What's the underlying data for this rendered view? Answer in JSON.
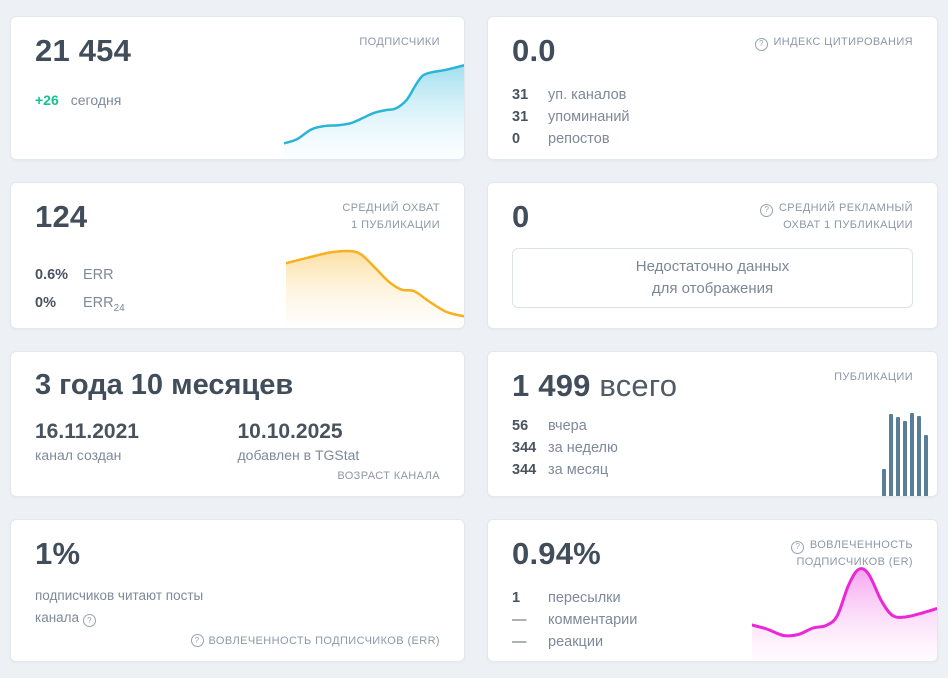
{
  "icons": {
    "help": "?"
  },
  "colors": {
    "background": "#edf0f5",
    "accent_green": "#11c58c",
    "bars": "#5b7e98"
  },
  "cards": {
    "subscribers": {
      "label": "ПОДПИСЧИКИ",
      "value": "21 454",
      "delta": "+26",
      "delta_label": "сегодня",
      "chart": {
        "type": "area",
        "color": "#29b4d8",
        "fill_from": "rgba(86,197,226,0.55)",
        "fill_to": "rgba(190,235,248,0.05)",
        "stroke_width": 2.5,
        "points": [
          [
            0,
            0.84
          ],
          [
            0.07,
            0.8
          ],
          [
            0.15,
            0.7
          ],
          [
            0.22,
            0.665
          ],
          [
            0.3,
            0.655
          ],
          [
            0.37,
            0.635
          ],
          [
            0.44,
            0.58
          ],
          [
            0.5,
            0.53
          ],
          [
            0.57,
            0.5
          ],
          [
            0.62,
            0.485
          ],
          [
            0.68,
            0.4
          ],
          [
            0.73,
            0.25
          ],
          [
            0.77,
            0.15
          ],
          [
            0.82,
            0.115
          ],
          [
            0.9,
            0.09
          ],
          [
            1,
            0.045
          ]
        ]
      }
    },
    "citation": {
      "label": "ИНДЕКС ЦИТИРОВАНИЯ",
      "value": "0.0",
      "rows": [
        {
          "value": "31",
          "label": "уп. каналов"
        },
        {
          "value": "31",
          "label": "упоминаний"
        },
        {
          "value": "0",
          "label": "репостов"
        }
      ]
    },
    "avg_reach": {
      "label_line1": "СРЕДНИЙ ОХВАТ",
      "label_line2": "1 ПУБЛИКАЦИИ",
      "value": "124",
      "rows": [
        {
          "value": "0.6%",
          "label": "ERR",
          "sub": ""
        },
        {
          "value": "0%",
          "label": "ERR",
          "sub": "24"
        }
      ],
      "chart": {
        "type": "area",
        "color": "#f7b01e",
        "fill_from": "rgba(249,185,50,0.45)",
        "fill_to": "rgba(253,238,205,0.06)",
        "stroke_width": 2.5,
        "points": [
          [
            0,
            0.28
          ],
          [
            0.12,
            0.22
          ],
          [
            0.25,
            0.16
          ],
          [
            0.35,
            0.145
          ],
          [
            0.42,
            0.18
          ],
          [
            0.5,
            0.33
          ],
          [
            0.58,
            0.49
          ],
          [
            0.65,
            0.575
          ],
          [
            0.72,
            0.59
          ],
          [
            0.8,
            0.7
          ],
          [
            0.9,
            0.82
          ],
          [
            1,
            0.87
          ]
        ]
      }
    },
    "ad_reach": {
      "label_line1": "СРЕДНИЙ РЕКЛАМНЫЙ",
      "label_line2": "ОХВАТ 1 ПУБЛИКАЦИИ",
      "value": "0",
      "empty_line1": "Недостаточно данных",
      "empty_line2": "для отображения"
    },
    "age": {
      "value": "3 года 10 месяцев",
      "created_date": "16.11.2021",
      "created_label": "канал создан",
      "added_date": "10.10.2025",
      "added_label": "добавлен в TGStat",
      "footer": "ВОЗРАСТ КАНАЛА"
    },
    "publications": {
      "label": "ПУБЛИКАЦИИ",
      "value": "1 499",
      "value_suffix": "всего",
      "rows": [
        {
          "value": "56",
          "label": "вчера"
        },
        {
          "value": "344",
          "label": "за неделю"
        },
        {
          "value": "344",
          "label": "за месяц"
        }
      ],
      "bars": {
        "color": "#5b7e98",
        "values": [
          0.33,
          0.99,
          0.95,
          0.9,
          1.0,
          0.97,
          0.74
        ]
      }
    },
    "err": {
      "value": "1%",
      "desc_line1": "подписчиков читают посты",
      "desc_line2": "канала",
      "footer": "ВОВЛЕЧЕННОСТЬ ПОДПИСЧИКОВ (ERR)"
    },
    "er": {
      "label_line1": "ВОВЛЕЧЕННОСТЬ",
      "label_line2": "ПОДПИСЧИКОВ (ER)",
      "value": "0.94%",
      "rows": [
        {
          "value": "1",
          "label": "пересылки"
        },
        {
          "value": "—",
          "label": "комментарии"
        },
        {
          "value": "—",
          "label": "реакции"
        }
      ],
      "chart": {
        "type": "area",
        "color": "#eb28d5",
        "fill_from": "rgba(238,90,226,0.55)",
        "fill_to": "rgba(250,200,245,0.08)",
        "stroke_width": 3,
        "points": [
          [
            0,
            0.64
          ],
          [
            0.08,
            0.68
          ],
          [
            0.17,
            0.745
          ],
          [
            0.25,
            0.735
          ],
          [
            0.33,
            0.67
          ],
          [
            0.4,
            0.645
          ],
          [
            0.46,
            0.55
          ],
          [
            0.52,
            0.25
          ],
          [
            0.575,
            0.085
          ],
          [
            0.63,
            0.13
          ],
          [
            0.7,
            0.4
          ],
          [
            0.76,
            0.545
          ],
          [
            0.83,
            0.56
          ],
          [
            0.92,
            0.52
          ],
          [
            1,
            0.475
          ]
        ]
      }
    }
  }
}
